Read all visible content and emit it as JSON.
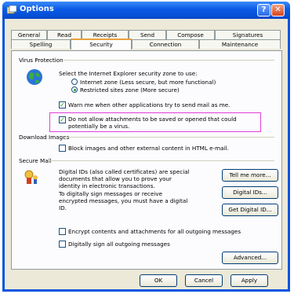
{
  "window": {
    "title": "Options"
  },
  "titlebar": {
    "help_glyph": "?",
    "close_glyph": "✕"
  },
  "tabs_row1": [
    "General",
    "Read",
    "Receipts",
    "Send",
    "Compose",
    "Signatures"
  ],
  "tabs_row2": [
    "Spelling",
    "Security",
    "Connection",
    "Maintenance"
  ],
  "virus": {
    "group": "Virus Protection",
    "zone_prompt": "Select the Internet Explorer security zone to use:",
    "zone_internet": "Internet zone (Less secure, but more functional)",
    "zone_restricted": "Restricted sites zone (More secure)",
    "zone_selected": "restricted",
    "warn_label": "Warn me when other applications try to send mail as me.",
    "warn_checked": true,
    "block_att_label": "Do not allow attachments to be saved or opened that could potentially be a virus.",
    "block_att_checked": true
  },
  "download": {
    "group": "Download Images",
    "block_images_label": "Block images and other external content in HTML e-mail.",
    "block_images_checked": false
  },
  "secure": {
    "group": "Secure Mail",
    "digital_ids_text": "Digital IDs (also called certificates) are special documents that allow you to prove your identity in electronic transactions.",
    "sign_text": "To digitally sign messages or receive encrypted messages, you must have a digital ID.",
    "tell_more": "Tell me more...",
    "digital_ids_btn": "Digital IDs...",
    "get_id_btn": "Get Digital ID...",
    "encrypt_label": "Encrypt contents and attachments for all outgoing messages",
    "encrypt_checked": false,
    "sign_label": "Digitally sign all outgoing messages",
    "sign_checked": false,
    "advanced_btn": "Advanced..."
  },
  "footer": {
    "ok": "OK",
    "cancel": "Cancel",
    "apply": "Apply"
  },
  "colors": {
    "titlebar": "#0a54df",
    "highlight": "#e040d8",
    "face": "#ece9d8"
  }
}
